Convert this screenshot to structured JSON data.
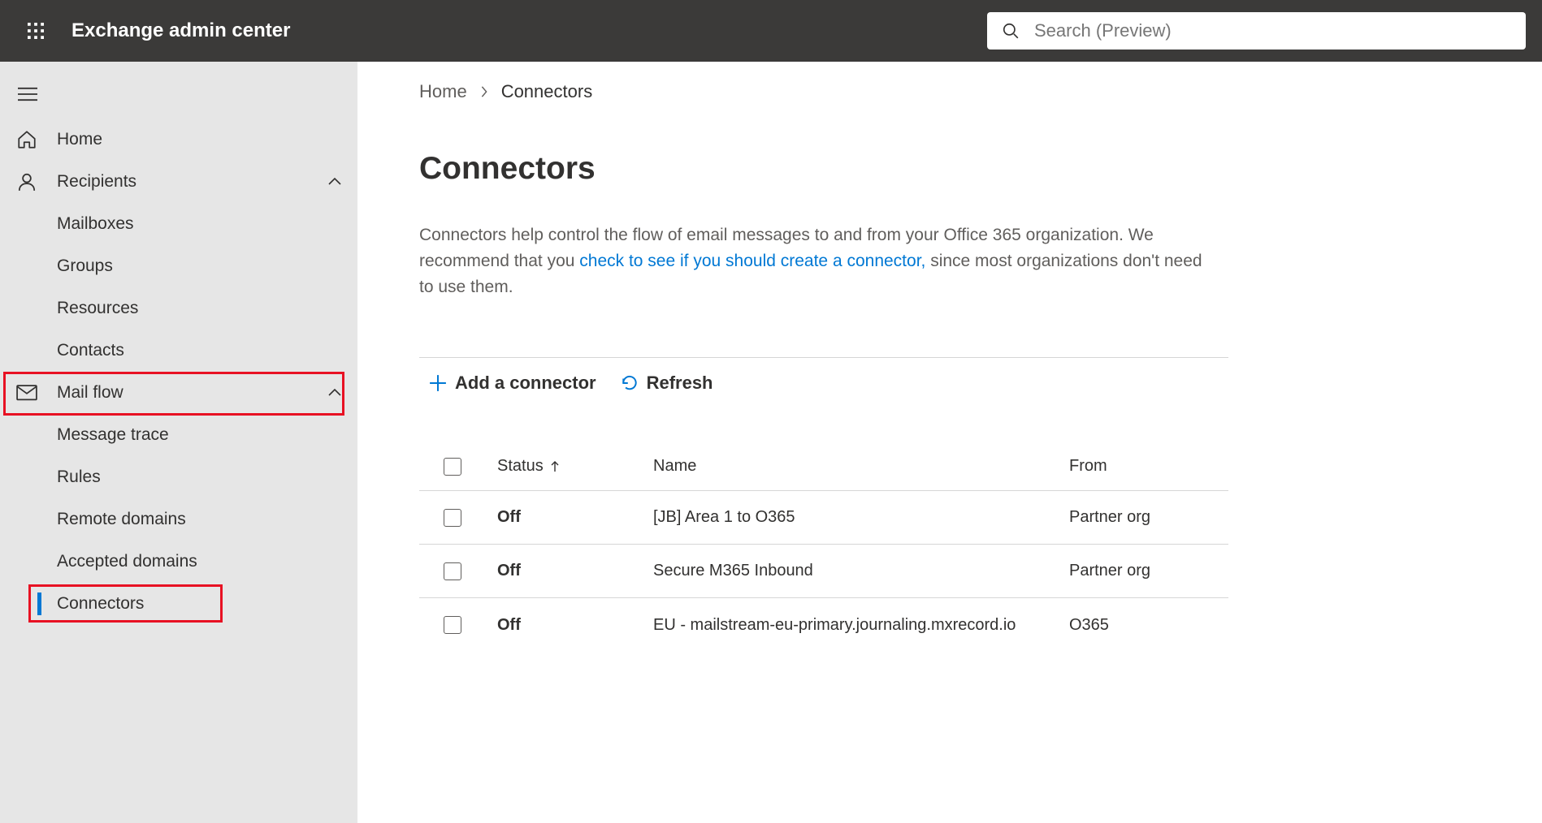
{
  "header": {
    "app_title": "Exchange admin center",
    "search_placeholder": "Search (Preview)"
  },
  "sidebar": {
    "items": [
      {
        "label": "Home",
        "icon": "home-icon",
        "type": "top"
      },
      {
        "label": "Recipients",
        "icon": "person-icon",
        "type": "top",
        "expanded": true
      },
      {
        "label": "Mailboxes",
        "type": "sub"
      },
      {
        "label": "Groups",
        "type": "sub"
      },
      {
        "label": "Resources",
        "type": "sub"
      },
      {
        "label": "Contacts",
        "type": "sub"
      },
      {
        "label": "Mail flow",
        "icon": "mail-icon",
        "type": "top",
        "expanded": true,
        "highlight_red": true
      },
      {
        "label": "Message trace",
        "type": "sub"
      },
      {
        "label": "Rules",
        "type": "sub"
      },
      {
        "label": "Remote domains",
        "type": "sub"
      },
      {
        "label": "Accepted domains",
        "type": "sub"
      },
      {
        "label": "Connectors",
        "type": "sub",
        "active": true,
        "highlight_red": true
      }
    ]
  },
  "breadcrumb": {
    "home": "Home",
    "current": "Connectors"
  },
  "page": {
    "title": "Connectors",
    "description_pre": "Connectors help control the flow of email messages to and from your Office 365 organization. We recommend that you ",
    "description_link": "check to see if you should create a connector,",
    "description_post": " since most organizations don't need to use them."
  },
  "toolbar": {
    "add_label": "Add a connector",
    "refresh_label": "Refresh"
  },
  "table": {
    "columns": {
      "status": "Status",
      "name": "Name",
      "from": "From"
    },
    "rows": [
      {
        "status": "Off",
        "name": "[JB] Area 1 to O365",
        "from": "Partner org"
      },
      {
        "status": "Off",
        "name": "Secure M365 Inbound",
        "from": "Partner org"
      },
      {
        "status": "Off",
        "name": "EU - mailstream-eu-primary.journaling.mxrecord.io",
        "from": "O365"
      }
    ]
  }
}
